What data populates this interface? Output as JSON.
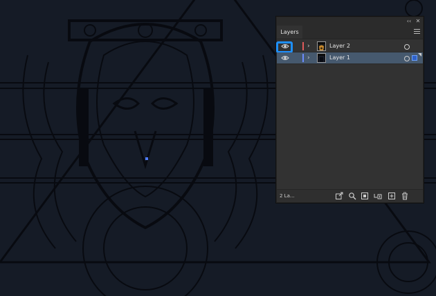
{
  "panel": {
    "collapse_icon": "double-chevron-icon",
    "close_icon": "close-icon",
    "tab_label": "Layers",
    "menu_icon": "hamburger-menu-icon"
  },
  "layers": [
    {
      "name": "Layer 2",
      "color": "#e05a5a",
      "visible": true,
      "selected": false
    },
    {
      "name": "Layer 1",
      "color": "#6b8cff",
      "visible": true,
      "selected": true
    }
  ],
  "footer": {
    "layer_count": "2 La...",
    "icons": [
      "export-icon",
      "search-icon",
      "clip-mask-icon",
      "sublayer-icon",
      "new-layer-icon",
      "delete-icon"
    ]
  },
  "colors": {
    "highlight": "#1e90ff",
    "selected_row": "#46596e",
    "canvas_bg": "#151b26",
    "artwork_line": "#05070c"
  }
}
